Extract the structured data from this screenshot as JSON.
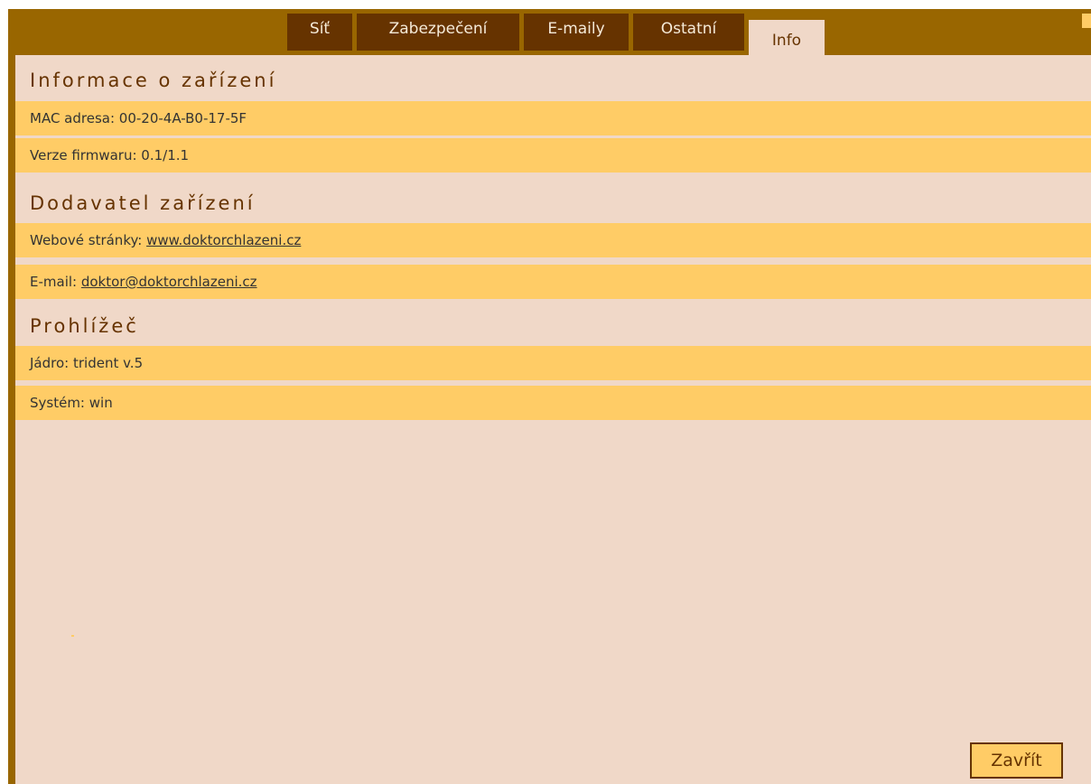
{
  "tabs": [
    {
      "label": "Síť",
      "active": false
    },
    {
      "label": "Zabezpečení",
      "active": false
    },
    {
      "label": "E-maily",
      "active": false
    },
    {
      "label": "Ostatní",
      "active": false
    },
    {
      "label": "Info",
      "active": true
    }
  ],
  "sections": {
    "device": {
      "title": "Informace o zařízení",
      "mac": "MAC adresa: 00-20-4A-B0-17-5F",
      "firmware": "Verze firmwaru: 0.1/1.1"
    },
    "vendor": {
      "title": "Dodavatel zařízení",
      "web_label": "Webové stránky: ",
      "web_link": "www.doktorchlazeni.cz",
      "email_label": "E-mail: ",
      "email_link": "doktor@doktorchlazeni.cz"
    },
    "browser": {
      "title": "Prohlížeč",
      "engine": "Jádro: trident v.5",
      "system": "Systém: win"
    }
  },
  "close_button": "Zavřít",
  "colors": {
    "frame": "#996600",
    "tab": "#663300",
    "content_bg": "#f0d8c8",
    "row_bg": "#ffcc66",
    "text": "#663300"
  }
}
